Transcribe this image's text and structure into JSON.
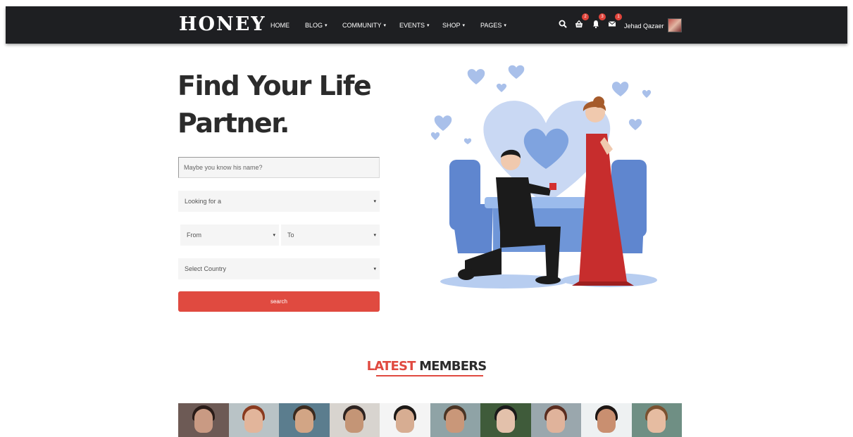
{
  "navbar": {
    "brand": "HONEY",
    "items": [
      {
        "label": "HOME",
        "dropdown": false
      },
      {
        "label": "BLOG",
        "dropdown": true
      },
      {
        "label": "COMMUNITY",
        "dropdown": true
      },
      {
        "label": "EVENTS",
        "dropdown": true
      },
      {
        "label": "SHOP",
        "dropdown": true
      },
      {
        "label": "PAGES",
        "dropdown": true
      }
    ],
    "icons": [
      {
        "name": "search-icon"
      },
      {
        "name": "shopping-basket-icon",
        "badge": "2"
      },
      {
        "name": "bell-icon",
        "badge": "3"
      },
      {
        "name": "envelope-icon",
        "badge": "1"
      }
    ],
    "username": "Jehad Qazaer",
    "caret": "▾"
  },
  "hero": {
    "title_line1": "Find Your Life",
    "title_line2": "Partner.",
    "name_placeholder": "Maybe you know his name?",
    "looking_for": "Looking for a",
    "from": "From",
    "to": "To",
    "country": "Select Country",
    "search_label": "search",
    "select_arrow": "▾"
  },
  "latest_members": {
    "title_accent": "LATEST",
    "title_rest": "MEMBERS",
    "members": [
      {
        "bg": "#6d5a55",
        "skin": "#c99a83",
        "hair": "#2a1c18"
      },
      {
        "bg": "#b9c3c6",
        "skin": "#e2b59b",
        "hair": "#8a3b1f"
      },
      {
        "bg": "#5b7d8e",
        "skin": "#d2a585",
        "hair": "#3b2a1e"
      },
      {
        "bg": "#d8d4cf",
        "skin": "#c49576",
        "hair": "#2d2320"
      },
      {
        "bg": "#f4f4f4",
        "skin": "#d7ad92",
        "hair": "#1c1816"
      },
      {
        "bg": "#8fa3a6",
        "skin": "#c99779",
        "hair": "#4a3424"
      },
      {
        "bg": "#3f5b3a",
        "skin": "#e3c1ab",
        "hair": "#1a1a1a"
      },
      {
        "bg": "#9aa7ad",
        "skin": "#e0b39b",
        "hair": "#5a2d20"
      },
      {
        "bg": "#eef1f2",
        "skin": "#c98f70",
        "hair": "#1d1614"
      },
      {
        "bg": "#6f8f84",
        "skin": "#e6bca1",
        "hair": "#7a5130"
      }
    ]
  },
  "colors": {
    "navbar_bg": "#1e1f22",
    "accent": "#e04a40",
    "heading": "#2b2b2b",
    "field_bg": "#f5f5f5",
    "illustration_blue": "#6b8fd1"
  }
}
